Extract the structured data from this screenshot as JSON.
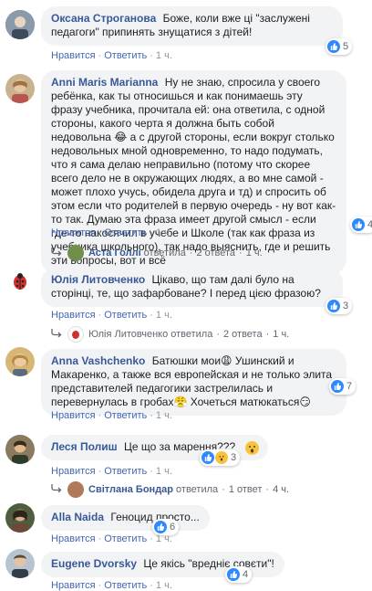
{
  "actions": {
    "like": "Нравится",
    "reply": "Ответить",
    "dot": "·"
  },
  "comments": [
    {
      "name": "Оксана Строганова",
      "text": "Боже, коли вже ці \"заслужені педагоги\" припинять знущатися з дітей!",
      "time": "1 ч.",
      "likes": "5"
    },
    {
      "name": "Anni Maris Marianna",
      "text": "Ну не знаю, спросила у своего ребёнка, как ты относишься и как понимаешь эту фразу учебника, прочитала ей: она ответила, с одной стороны, какого черта я должна быть собой недовольна 😂 а с другой стороны, если вокруг столько недовольных мной одновременно, то надо подумать, что я сама делаю неправильно (потому что скорее всего дело не в окружающих людях, а во мне самой - может плохо учусь, обидела друга и тд) и спросить об этом если что родителей в первую очередь - ну вот как-то так. Думаю эта фраза имеет другой смысл - если где-то накосячил в учебе и Школе (так как фраза из учебника школьного), так надо выяснить, где и решить эти вопросы, вот и всё",
      "time": "1 ч.",
      "likes": "4",
      "replies": {
        "name": "Аста Голлі",
        "verb": "ответила",
        "count": "2 ответа",
        "time": "1 ч."
      }
    },
    {
      "name": "Юлія Литовченко",
      "text": "Цікаво, що там далі було на сторінці, те, що зафарбоване? І перед цією фразою?",
      "time": "1 ч.",
      "likes": "3",
      "replies": {
        "name": "Юлія Литовченко",
        "verb": "ответила",
        "count": "2 ответа",
        "time": "1 ч."
      }
    },
    {
      "name": "Anna Vashchenko",
      "text": "Батюшки мои😩 Ушинский и Макаренко, а также вся европейская и не только элита представителей педагогики застрелилась и перевернулась в гробах😤 Хочеться матюкаться😏",
      "time": "1 ч.",
      "likes": "7"
    },
    {
      "name": "Леся Полиш",
      "text": "Це що за марення???",
      "emoji": "😮",
      "time": "1 ч.",
      "likes": "3",
      "replies": {
        "name": "Світлана Бондар",
        "verb": "ответила",
        "count": "1 ответ",
        "time": "4 ч."
      }
    },
    {
      "name": "Alla Naida",
      "text": "Геноцид просто...",
      "time": "1 ч.",
      "likes": "6"
    },
    {
      "name": "Eugene Dvorsky",
      "text": "Це якісь \"вредніє совєти\"!",
      "time": "1 ч.",
      "likes": "4"
    }
  ]
}
